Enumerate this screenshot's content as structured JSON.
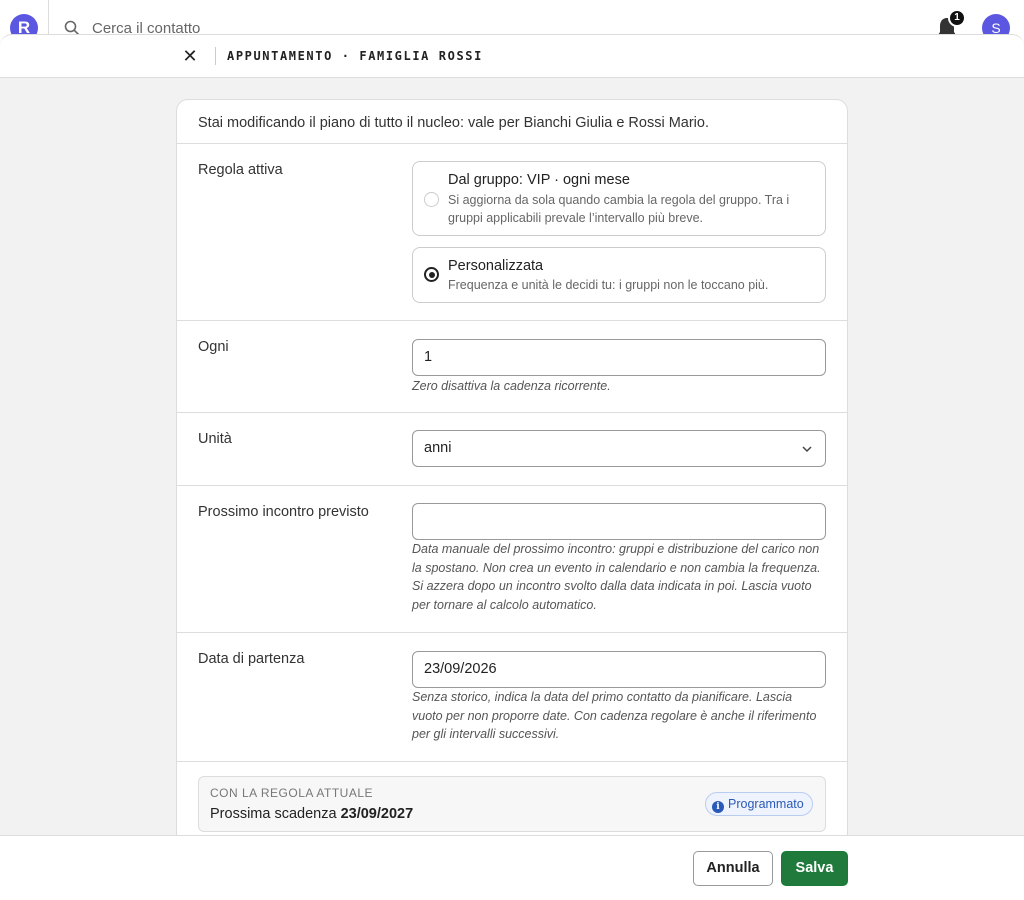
{
  "appbar": {
    "logo_letter": "R",
    "search_placeholder": "Cerca il contatto",
    "notifications_count": "1",
    "avatar_initial": "S"
  },
  "sheet": {
    "close_glyph": "✕",
    "title": "APPUNTAMENTO · FAMIGLIA ROSSI"
  },
  "form": {
    "intro": "Stai modificando il piano di tutto il nucleo: vale per Bianchi Giulia e Rossi Mario.",
    "rule": {
      "label": "Regola attiva",
      "options": [
        {
          "title": "Dal gruppo: VIP · ogni mese",
          "description": "Si aggiorna da sola quando cambia la regola del gruppo. Tra i gruppi applicabili prevale l’intervallo più breve.",
          "selected": false
        },
        {
          "title": "Personalizzata",
          "description": "Frequenza e unità le decidi tu: i gruppi non le toccano più.",
          "selected": true
        }
      ]
    },
    "every": {
      "label": "Ogni",
      "value": "1",
      "hint": "Zero disattiva la cadenza ricorrente."
    },
    "unit": {
      "label": "Unità",
      "value": "anni"
    },
    "next_meeting": {
      "label": "Prossimo incontro previsto",
      "value": "",
      "hint": "Data manuale del prossimo incontro: gruppi e distribuzione del carico non la spostano. Non crea un evento in calendario e non cambia la frequenza. Si azzera dopo un incontro svolto dalla data indicata in poi. Lascia vuoto per tornare al calcolo automatico."
    },
    "start_date": {
      "label": "Data di partenza",
      "value": "23/09/2026",
      "hint": "Senza storico, indica la data del primo contatto da pianificare. Lascia vuoto per non proporre date. Con cadenza regolare è anche il riferimento per gli intervalli successivi."
    },
    "summary": {
      "kicker": "CON LA REGOLA ATTUALE",
      "prefix": "Prossima scadenza ",
      "date": "23/09/2027",
      "status": "Programmato",
      "status_icon": "info-icon"
    }
  },
  "footer": {
    "cancel_label": "Annulla",
    "save_label": "Salva"
  },
  "colors": {
    "brand": "#5b57e0",
    "save": "#1f7a3b",
    "status_blue": "#2a5ab7"
  }
}
